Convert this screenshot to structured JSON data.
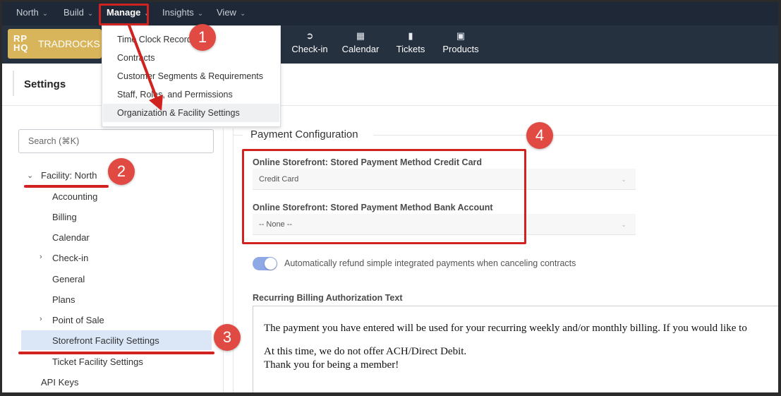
{
  "top_menu": {
    "items": [
      {
        "label": "North"
      },
      {
        "label": "Build"
      },
      {
        "label": "Manage"
      },
      {
        "label": "Insights"
      },
      {
        "label": "View"
      }
    ],
    "active_item": "Manage"
  },
  "navbar": {
    "logo_mark": "RP HQ",
    "logo_text": "TRADROCKS",
    "items": [
      {
        "label": "Check-in",
        "icon": "arrow-circle-icon"
      },
      {
        "label": "Calendar",
        "icon": "calendar-icon"
      },
      {
        "label": "Tickets",
        "icon": "chat-bubble-icon"
      },
      {
        "label": "Products",
        "icon": "boxes-icon"
      }
    ]
  },
  "dropdown": {
    "items": [
      {
        "label": "Time Clock Records"
      },
      {
        "label": "Contracts"
      },
      {
        "label": "Customer Segments & Requirements"
      },
      {
        "label": "Staff, Roles, and Permissions"
      },
      {
        "label": "Organization & Facility Settings"
      }
    ],
    "highlighted": "Organization & Facility Settings"
  },
  "settings": {
    "title": "Settings"
  },
  "sidebar": {
    "search_placeholder": "Search (⌘K)",
    "facility_label": "Facility: North",
    "items": [
      {
        "label": "Accounting"
      },
      {
        "label": "Billing"
      },
      {
        "label": "Calendar"
      },
      {
        "label": "Check-in"
      },
      {
        "label": "General"
      },
      {
        "label": "Plans"
      },
      {
        "label": "Point of Sale"
      },
      {
        "label": "Storefront Facility Settings"
      },
      {
        "label": "Ticket Facility Settings"
      }
    ],
    "api_keys_label": "API Keys",
    "selected": "Storefront Facility Settings"
  },
  "main": {
    "section_title": "Payment Configuration",
    "credit_card_label": "Online Storefront: Stored Payment Method Credit Card",
    "credit_card_value": "Credit Card",
    "bank_account_label": "Online Storefront: Stored Payment Method Bank Account",
    "bank_account_value": "-- None --",
    "toggle_label": "Automatically refund simple integrated payments when canceling contracts",
    "toggle_on": true,
    "recurring_label": "Recurring Billing Authorization Text",
    "recurring_lines": [
      "The payment you have entered will be used for your recurring weekly and/or monthly billing. If you would like to",
      "At this time, we do not offer ACH/Direct Debit.",
      "Thank you for being a member!"
    ]
  },
  "annotations": {
    "steps": [
      "1",
      "2",
      "3",
      "4"
    ],
    "color": "#d0231f"
  }
}
